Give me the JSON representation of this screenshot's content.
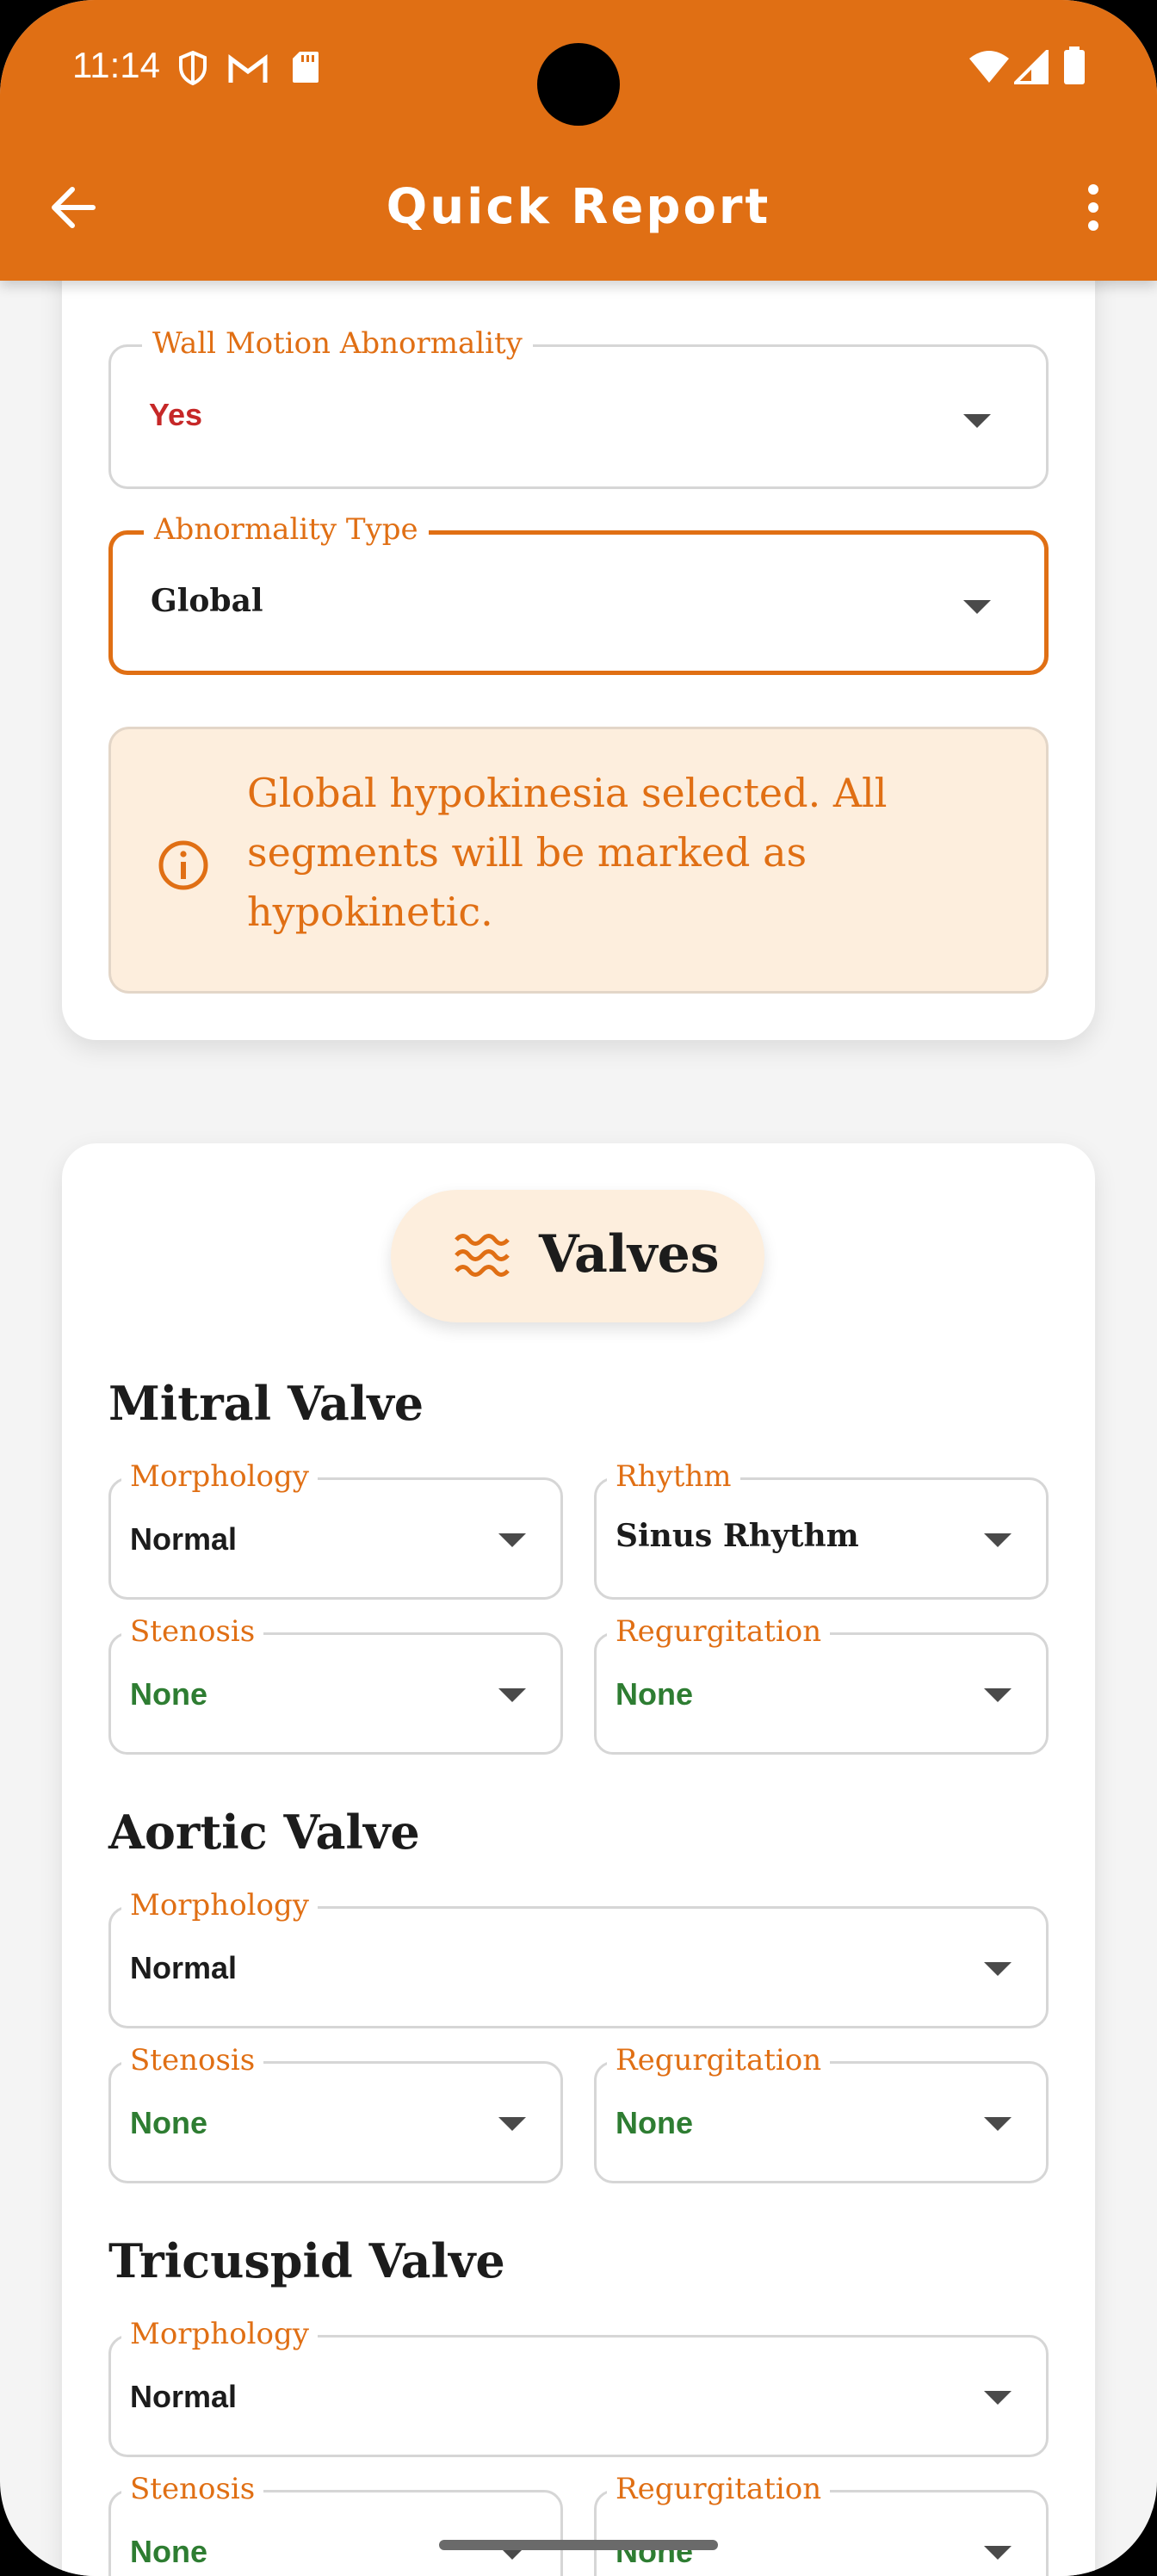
{
  "status_bar": {
    "time": "11:14"
  },
  "app_bar": {
    "title": "Quick Report"
  },
  "colors": {
    "accent": "#e06f14",
    "red_value": "#c62828",
    "green_value": "#2e7d32",
    "info_bg": "#fdeedd"
  },
  "wall_motion": {
    "abnormality": {
      "label": "Wall Motion Abnormality",
      "value": "Yes"
    },
    "type": {
      "label": "Abnormality Type",
      "value": "Global"
    },
    "info": "Global hypokinesia selected. All segments will be marked as hypokinetic."
  },
  "valves": {
    "title": "Valves",
    "mitral": {
      "title": "Mitral Valve",
      "morphology": {
        "label": "Morphology",
        "value": "Normal"
      },
      "rhythm": {
        "label": "Rhythm",
        "value": "Sinus Rhythm"
      },
      "stenosis": {
        "label": "Stenosis",
        "value": "None"
      },
      "regurgitation": {
        "label": "Regurgitation",
        "value": "None"
      }
    },
    "aortic": {
      "title": "Aortic Valve",
      "morphology": {
        "label": "Morphology",
        "value": "Normal"
      },
      "stenosis": {
        "label": "Stenosis",
        "value": "None"
      },
      "regurgitation": {
        "label": "Regurgitation",
        "value": "None"
      }
    },
    "tricuspid": {
      "title": "Tricuspid Valve",
      "morphology": {
        "label": "Morphology",
        "value": "Normal"
      },
      "stenosis": {
        "label": "Stenosis",
        "value": "None"
      },
      "regurgitation": {
        "label": "Regurgitation",
        "value": "None"
      }
    }
  }
}
